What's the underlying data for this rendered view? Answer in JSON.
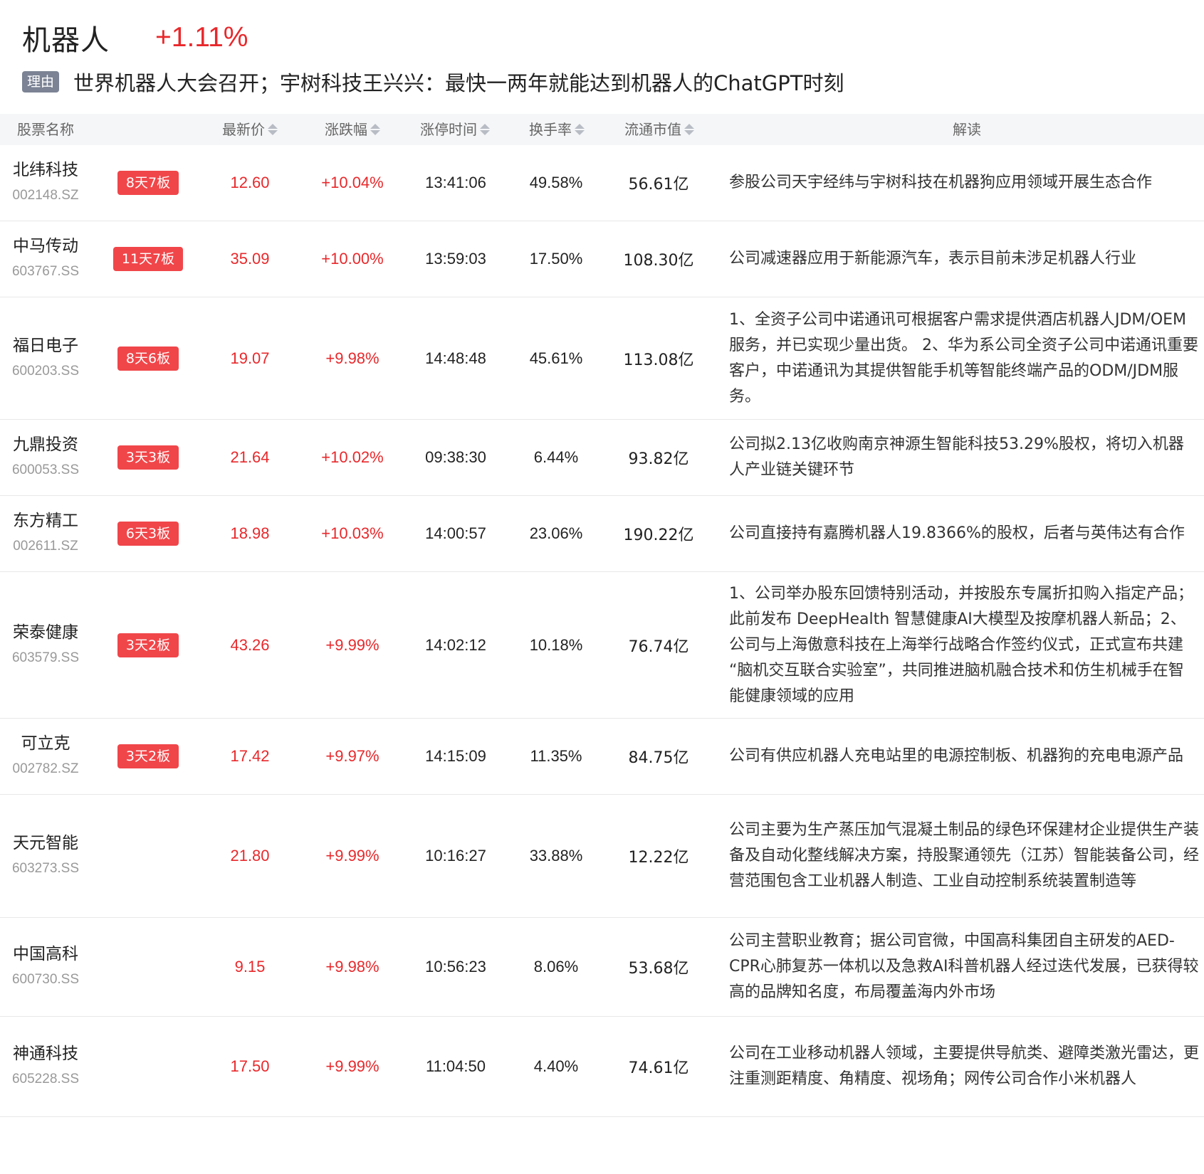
{
  "header": {
    "sector_name": "机器人",
    "sector_change": "+1.11%",
    "reason_badge": "理由",
    "reason_text": "世界机器人大会召开；宇树科技王兴兴：最快一两年就能达到机器人的ChatGPT时刻"
  },
  "columns": {
    "name": "股票名称",
    "price": "最新价",
    "change": "涨跌幅",
    "limit_time": "涨停时间",
    "turnover": "换手率",
    "float_cap": "流通市值",
    "desc": "解读"
  },
  "rows": [
    {
      "name": "北纬科技",
      "code": "002148.SZ",
      "tag": "8天7板",
      "price": "12.60",
      "change": "+10.04%",
      "time": "13:41:06",
      "turnover": "49.58%",
      "cap": "56.61亿",
      "desc": "参股公司天宇经纬与宇树科技在机器狗应用领域开展生态合作"
    },
    {
      "name": "中马传动",
      "code": "603767.SS",
      "tag": "11天7板",
      "price": "35.09",
      "change": "+10.00%",
      "time": "13:59:03",
      "turnover": "17.50%",
      "cap": "108.30亿",
      "desc": "公司减速器应用于新能源汽车，表示目前未涉足机器人行业"
    },
    {
      "name": "福日电子",
      "code": "600203.SS",
      "tag": "8天6板",
      "price": "19.07",
      "change": "+9.98%",
      "time": "14:48:48",
      "turnover": "45.61%",
      "cap": "113.08亿",
      "desc": "1、全资子公司中诺通讯可根据客户需求提供酒店机器人JDM/OEM服务，并已实现少量出货。 2、华为系公司全资子公司中诺通讯重要客户，中诺通讯为其提供智能手机等智能终端产品的ODM/JDM服务。"
    },
    {
      "name": "九鼎投资",
      "code": "600053.SS",
      "tag": "3天3板",
      "price": "21.64",
      "change": "+10.02%",
      "time": "09:38:30",
      "turnover": "6.44%",
      "cap": "93.82亿",
      "desc": "公司拟2.13亿收购南京神源生智能科技53.29%股权，将切入机器人产业链关键环节"
    },
    {
      "name": "东方精工",
      "code": "002611.SZ",
      "tag": "6天3板",
      "price": "18.98",
      "change": "+10.03%",
      "time": "14:00:57",
      "turnover": "23.06%",
      "cap": "190.22亿",
      "desc": "公司直接持有嘉腾机器人19.8366%的股权，后者与英伟达有合作"
    },
    {
      "name": "荣泰健康",
      "code": "603579.SS",
      "tag": "3天2板",
      "price": "43.26",
      "change": "+9.99%",
      "time": "14:02:12",
      "turnover": "10.18%",
      "cap": "76.74亿",
      "desc": "1、公司举办股东回馈特别活动，并按股东专属折扣购入指定产品；此前发布 DeepHealth 智慧健康AI大模型及按摩机器人新品；2、公司与上海傲意科技在上海举行战略合作签约仪式，正式宣布共建 “脑机交互联合实验室”，共同推进脑机融合技术和仿生机械手在智能健康领域的应用"
    },
    {
      "name": "可立克",
      "code": "002782.SZ",
      "tag": "3天2板",
      "price": "17.42",
      "change": "+9.97%",
      "time": "14:15:09",
      "turnover": "11.35%",
      "cap": "84.75亿",
      "desc": "公司有供应机器人充电站里的电源控制板、机器狗的充电电源产品"
    },
    {
      "name": "天元智能",
      "code": "603273.SS",
      "tag": "",
      "price": "21.80",
      "change": "+9.99%",
      "time": "10:16:27",
      "turnover": "33.88%",
      "cap": "12.22亿",
      "desc": "公司主要为生产蒸压加气混凝土制品的绿色环保建材企业提供生产装备及自动化整线解决方案，持股聚通领先（江苏）智能装备公司，经营范围包含工业机器人制造、工业自动控制系统装置制造等"
    },
    {
      "name": "中国高科",
      "code": "600730.SS",
      "tag": "",
      "price": "9.15",
      "change": "+9.98%",
      "time": "10:56:23",
      "turnover": "8.06%",
      "cap": "53.68亿",
      "desc": "公司主营职业教育；据公司官微，中国高科集团自主研发的AED-CPR心肺复苏一体机以及急救AI科普机器人经过迭代发展，已获得较高的品牌知名度，布局覆盖海内外市场"
    },
    {
      "name": "神通科技",
      "code": "605228.SS",
      "tag": "",
      "price": "17.50",
      "change": "+9.99%",
      "time": "11:04:50",
      "turnover": "4.40%",
      "cap": "74.61亿",
      "desc": "公司在工业移动机器人领域，主要提供导航类、避障类激光雷达，更注重测距精度、角精度、视场角；网传公司合作小米机器人"
    }
  ],
  "colors": {
    "up_red": "#e8282b",
    "tag_red": "#f0464a",
    "badge_gray": "#7b8394",
    "header_bg": "#f5f6f8"
  }
}
